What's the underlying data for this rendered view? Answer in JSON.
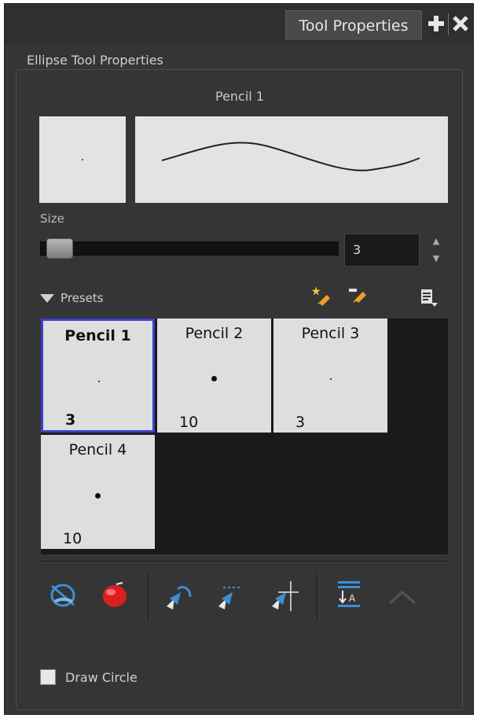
{
  "tab": {
    "title": "Tool Properties"
  },
  "group": {
    "title": "Ellipse Tool Properties"
  },
  "brush": {
    "name": "Pencil 1"
  },
  "size": {
    "label": "Size",
    "value": "3",
    "slider_fraction": 0.03
  },
  "presets": {
    "label": "Presets",
    "items": [
      {
        "name": "Pencil 1",
        "size": "3",
        "selected": true
      },
      {
        "name": "Pencil 2",
        "size": "10",
        "selected": false
      },
      {
        "name": "Pencil 3",
        "size": "3",
        "selected": false
      },
      {
        "name": "Pencil 4",
        "size": "10",
        "selected": false
      }
    ]
  },
  "options": {
    "draw_circle_label": "Draw Circle",
    "draw_circle_checked": false
  },
  "colors": {
    "panel": "#353535",
    "selection": "#3b3fd1",
    "accent": "#f0a020",
    "blue": "#3a8fd8",
    "red": "#d82020"
  }
}
